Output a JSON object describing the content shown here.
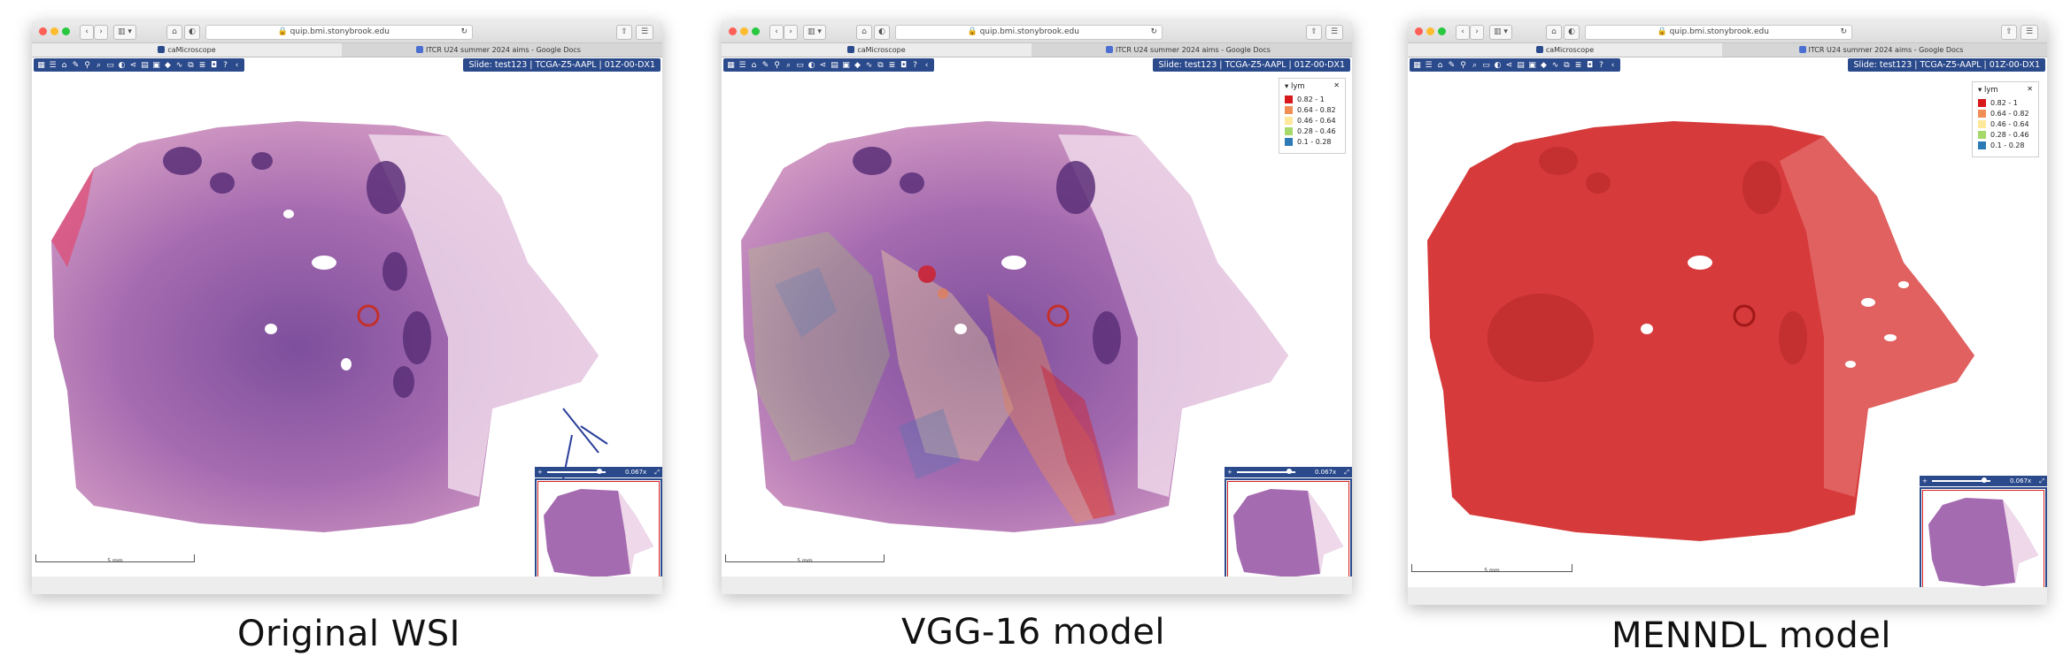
{
  "browser": {
    "url": "quip.bmi.stonybrook.edu",
    "tabs": [
      {
        "label": "caMicroscope"
      },
      {
        "label": "ITCR U24 summer 2024 aims - Google Docs"
      }
    ]
  },
  "app": {
    "slide_label": "Slide: test123 | TCGA-Z5-AAPL | 01Z-00-DX1",
    "tool_icons": [
      "grid-icon",
      "list-icon",
      "home-icon",
      "pen-icon",
      "eyedropper-icon",
      "search-icon",
      "ruler-icon",
      "contrast-icon",
      "share-icon",
      "layers-icon",
      "image-icon",
      "tag-icon",
      "chart-icon",
      "compare-icon",
      "doc-icon",
      "camera-icon",
      "help-icon",
      "collapse-icon"
    ],
    "legend": {
      "title": "lym",
      "items": [
        {
          "label": "0.82 - 1",
          "color": "#d7191c"
        },
        {
          "label": "0.64 - 0.82",
          "color": "#f18e56"
        },
        {
          "label": "0.46 - 0.64",
          "color": "#fee89b"
        },
        {
          "label": "0.28 - 0.46",
          "color": "#a6d96a"
        },
        {
          "label": "0.1 - 0.28",
          "color": "#2c7bb6"
        }
      ]
    },
    "scale_label": "5 mm"
  },
  "panels": [
    {
      "caption": "Original WSI",
      "zoom": "0.067x",
      "overlay": "none"
    },
    {
      "caption": "VGG-16 model",
      "zoom": "0.067x",
      "overlay": "heatmap"
    },
    {
      "caption": "MENNDL model",
      "zoom": "0.067x",
      "overlay": "red"
    }
  ],
  "colors": {
    "tissue_pink": "#c98ab8",
    "tissue_purple": "#8a5aa6",
    "tissue_dark": "#5a2f78",
    "mask_red": "#d63a3a",
    "ui_blue": "#2b4a8c"
  }
}
